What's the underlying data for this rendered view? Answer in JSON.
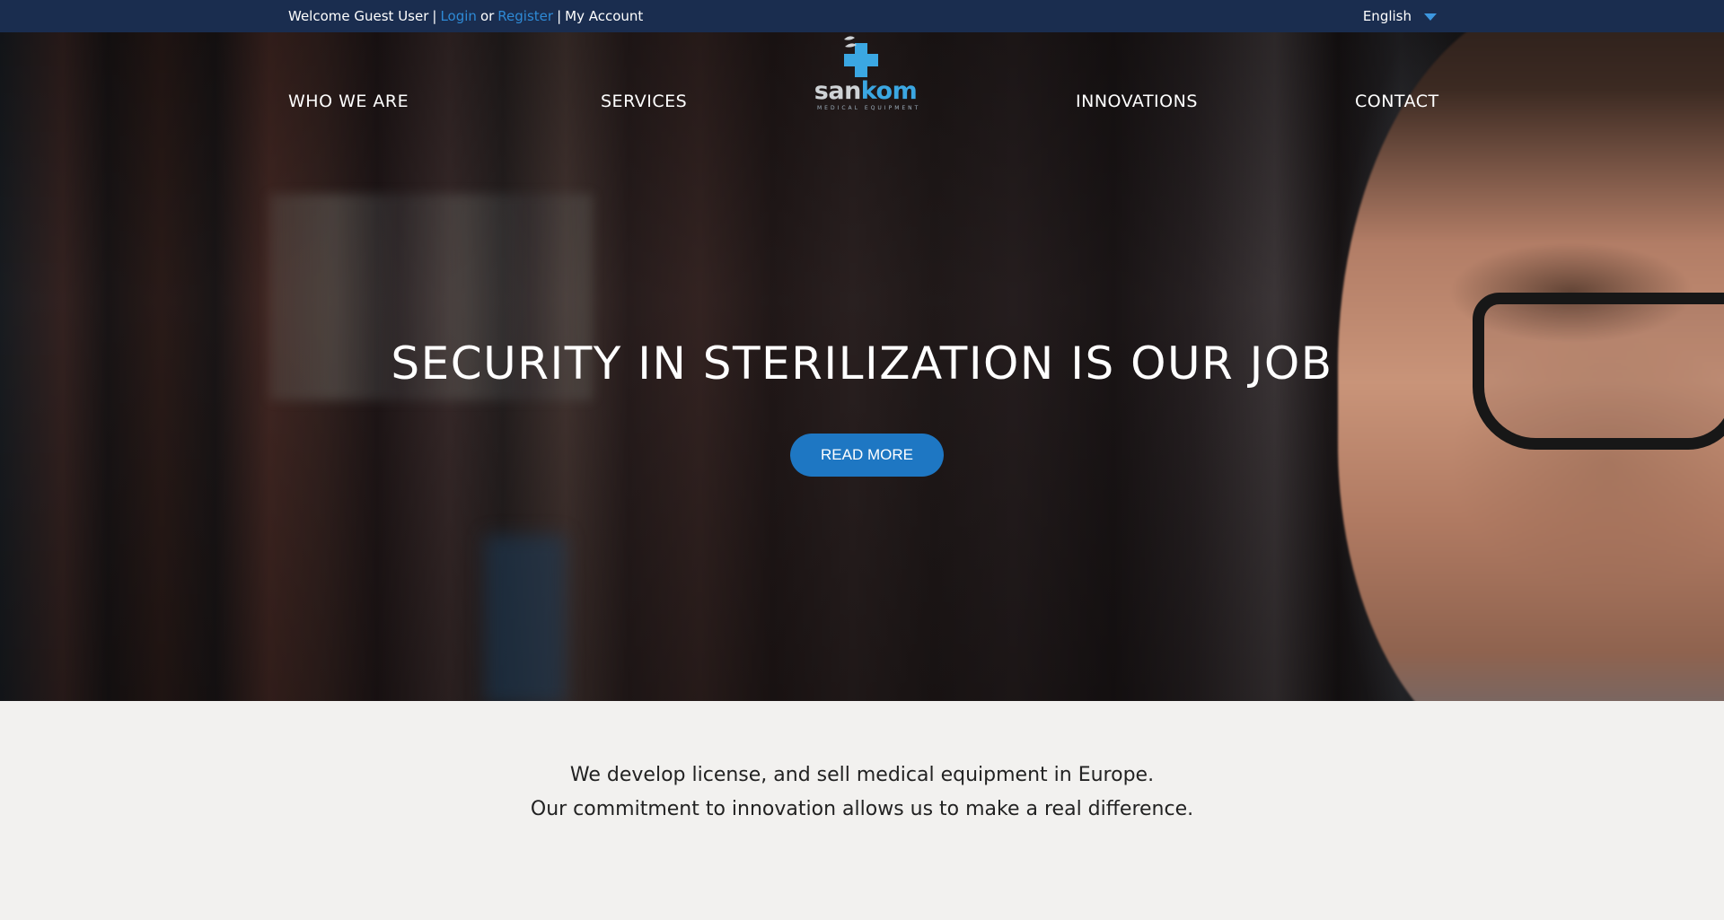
{
  "topbar": {
    "welcome": "Welcome Guest User",
    "sep1": "|",
    "login": "Login",
    "or": "or",
    "register": "Register",
    "sep2": "|",
    "account": "My Account",
    "language": "English"
  },
  "nav": {
    "items": [
      "WHO WE ARE",
      "SERVICES",
      "INNOVATIONS",
      "CONTACT"
    ]
  },
  "logo": {
    "word_a": "san",
    "word_b": "kom",
    "tagline": "MEDICAL EQUIPMENT"
  },
  "hero": {
    "headline": "SECURITY IN STERILIZATION IS OUR JOB",
    "cta": "READ MORE"
  },
  "intro": {
    "line1": "We develop license, and sell medical equipment in Europe.",
    "line2": "Our commitment to innovation allows us to make a real difference."
  },
  "colors": {
    "topbar_bg": "#1a2d4f",
    "link": "#2e8ad6",
    "cta_bg": "#1e77c3",
    "logo_accent": "#3ba7e2",
    "section_bg": "#f2f1ef"
  },
  "icons": [
    "dropdown-caret-icon",
    "medical-cross-icon"
  ]
}
